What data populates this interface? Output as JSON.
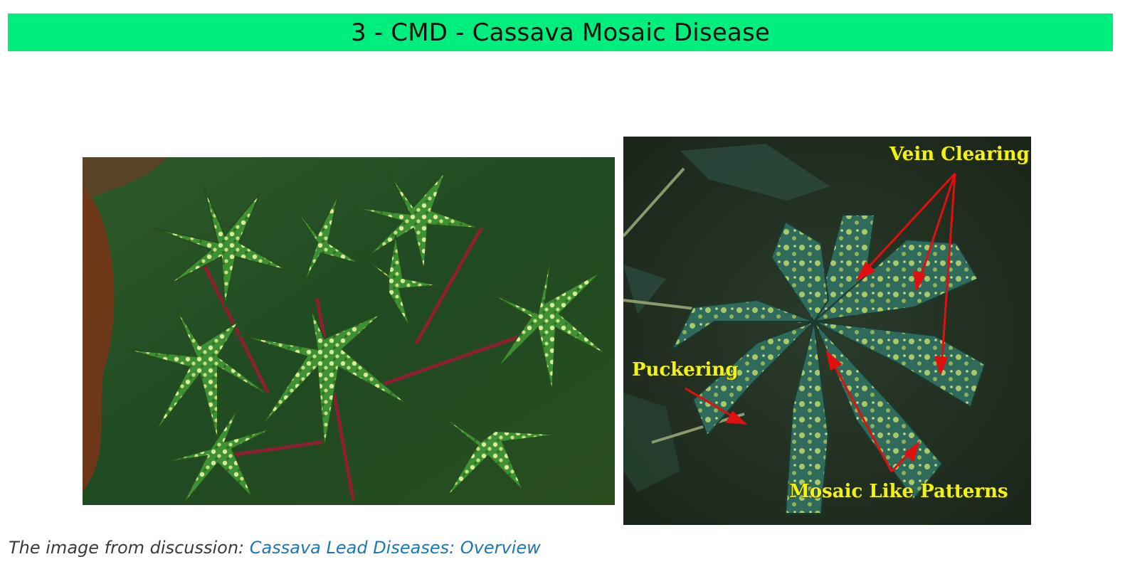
{
  "banner": {
    "title": "3 - CMD - Cassava Mosaic Disease",
    "color": "#00ee7d"
  },
  "images": {
    "left_photo": "cassava-plants-mosaic-photo",
    "right_photo": "cassava-leaf-annotated-photo"
  },
  "annotations": {
    "vein_clearing": "Vein Clearing",
    "puckering": "Puckering",
    "mosaic_patterns": "Mosaic Like Patterns",
    "label_color": "#f2f21a",
    "arrow_color": "#e01010"
  },
  "caption": {
    "prefix": "The image from discussion: ",
    "link_text": "Cassava Lead Diseases: Overview",
    "link_color": "#1e78b4"
  }
}
